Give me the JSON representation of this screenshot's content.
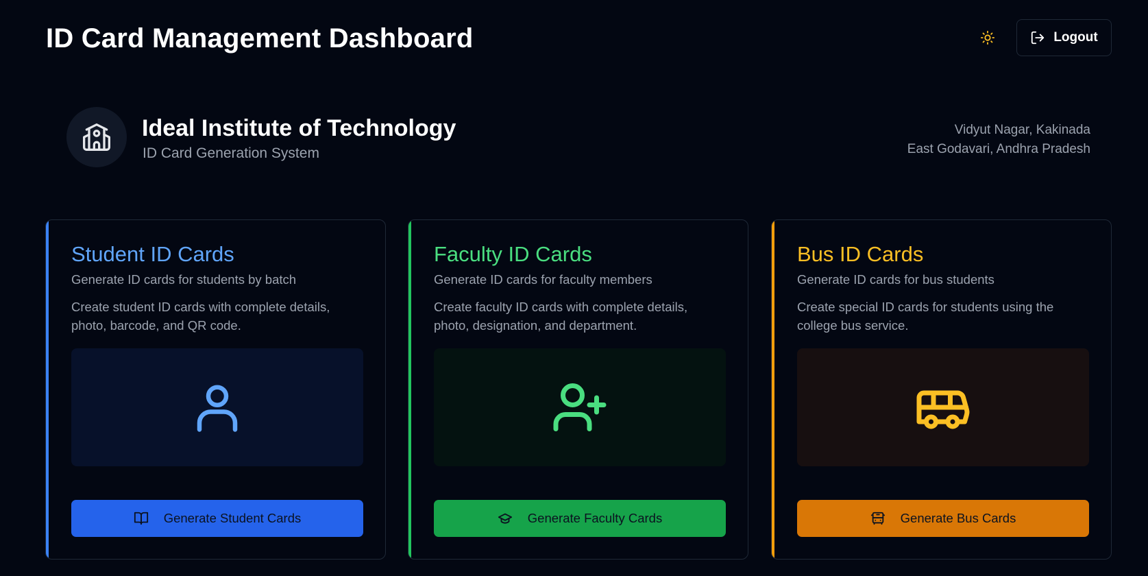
{
  "header": {
    "title": "ID Card Management Dashboard",
    "theme_icon": "sun-icon",
    "logout_icon": "logout-icon",
    "logout_label": "Logout"
  },
  "institute": {
    "icon": "school-icon",
    "name": "Ideal Institute of Technology",
    "subtitle": "ID Card Generation System",
    "address_line1": "Vidyut Nagar, Kakinada",
    "address_line2": "East Godavari, Andhra Pradesh"
  },
  "cards": [
    {
      "title": "Student ID Cards",
      "subtitle": "Generate ID cards for students by batch",
      "description": "Create student ID cards with complete details, photo, barcode, and QR code.",
      "illustration_icon": "user-icon",
      "button_icon": "book-open-icon",
      "button_label": "Generate Student Cards",
      "accent_color": "#60a5fa",
      "button_color": "#2563eb"
    },
    {
      "title": "Faculty ID Cards",
      "subtitle": "Generate ID cards for faculty members",
      "description": "Create faculty ID cards with complete details, photo, designation, and department.",
      "illustration_icon": "user-plus-icon",
      "button_icon": "graduation-cap-icon",
      "button_label": "Generate Faculty Cards",
      "accent_color": "#4ade80",
      "button_color": "#16a34a"
    },
    {
      "title": "Bus ID Cards",
      "subtitle": "Generate ID cards for bus students",
      "description": "Create special ID cards for students using the college bus service.",
      "illustration_icon": "bus-icon",
      "button_icon": "bus-icon",
      "button_label": "Generate Bus Cards",
      "accent_color": "#fbbf24",
      "button_color": "#d97706"
    }
  ]
}
